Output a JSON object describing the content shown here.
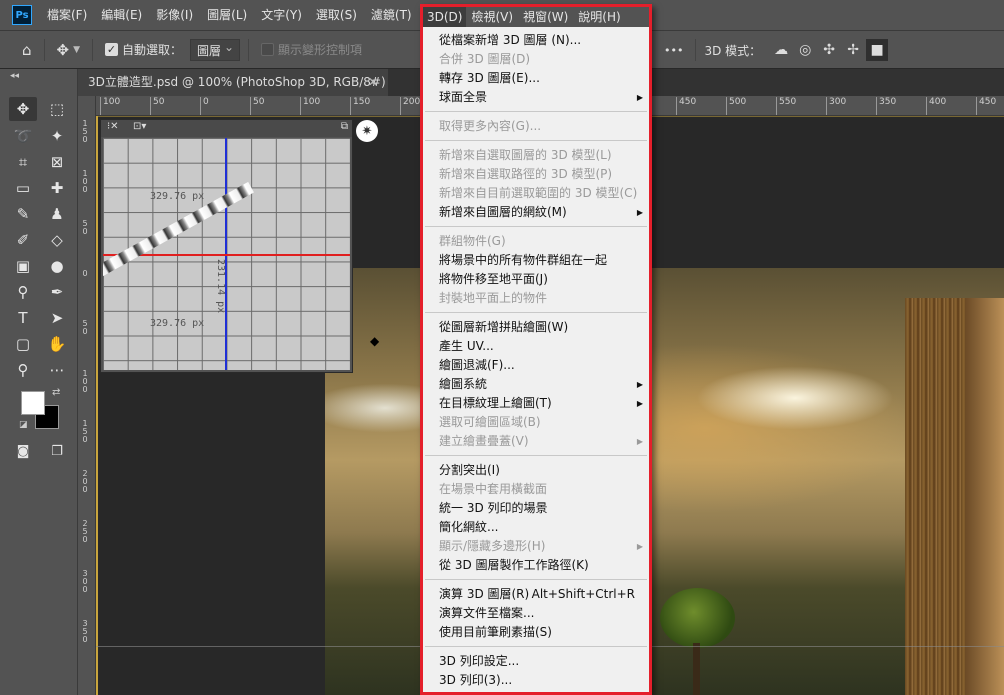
{
  "menubar": {
    "logo": "Ps",
    "items": [
      "檔案(F)",
      "編輯(E)",
      "影像(I)",
      "圖層(L)",
      "文字(Y)",
      "選取(S)",
      "濾鏡(T)",
      "3D(D)",
      "檢視(V)",
      "視窗(W)",
      "說明(H)"
    ]
  },
  "options": {
    "auto_select_label": "自動選取：",
    "auto_select_value": "圖層",
    "transform_controls_label": "顯示變形控制項",
    "more": "•••",
    "mode_label": "3D 模式："
  },
  "document": {
    "tab_title": "3D立體造型.psd @ 100% (PhotoShop 3D, RGB/8#)",
    "close": "✕"
  },
  "ruler": {
    "h_ticks": [
      "100",
      "50",
      "0",
      "50",
      "100",
      "150",
      "200",
      "250",
      "300",
      "350",
      "400",
      "450",
      "500",
      "550"
    ],
    "v_ticks": [
      "1 5 0",
      "1 0 0",
      "5 0",
      "0",
      "5 0",
      "1 0 0",
      "1 5 0",
      "2 0 0",
      "2 5 0",
      "3 0 0",
      "3 5 0",
      "4 0 0"
    ]
  },
  "secondary_view": {
    "dim_top": "329.76 px",
    "dim_bottom": "329.76 px",
    "dim_vertical": "231.14 px"
  },
  "dropdown": {
    "head_items": [
      "3D(D)",
      "檢視(V)",
      "視窗(W)",
      "說明(H)"
    ],
    "items": [
      {
        "label": "從檔案新增 3D 圖層 (N)...",
        "disabled": false
      },
      {
        "label": "合併 3D 圖層(D)",
        "disabled": true
      },
      {
        "label": "轉存 3D 圖層(E)...",
        "disabled": false
      },
      {
        "label": "球面全景",
        "disabled": false,
        "submenu": true
      },
      {
        "sep": true
      },
      {
        "label": "取得更多內容(G)...",
        "disabled": true
      },
      {
        "sep": true
      },
      {
        "label": "新增來自選取圖層的 3D 模型(L)",
        "disabled": true
      },
      {
        "label": "新增來自選取路徑的 3D 模型(P)",
        "disabled": true
      },
      {
        "label": "新增來自目前選取範圍的 3D 模型(C)",
        "disabled": true
      },
      {
        "label": "新增來自圖層的網紋(M)",
        "disabled": false,
        "submenu": true
      },
      {
        "sep": true
      },
      {
        "label": "群組物件(G)",
        "disabled": true
      },
      {
        "label": "將場景中的所有物件群組在一起",
        "disabled": false
      },
      {
        "label": "將物件移至地平面(J)",
        "disabled": false
      },
      {
        "label": "封裝地平面上的物件",
        "disabled": true
      },
      {
        "sep": true
      },
      {
        "label": "從圖層新增拼貼繪圖(W)",
        "disabled": false
      },
      {
        "label": "產生 UV...",
        "disabled": false
      },
      {
        "label": "繪圖退減(F)...",
        "disabled": false
      },
      {
        "label": "繪圖系統",
        "disabled": false,
        "submenu": true
      },
      {
        "label": "在目標紋理上繪圖(T)",
        "disabled": false,
        "submenu": true
      },
      {
        "label": "選取可繪圖區域(B)",
        "disabled": true
      },
      {
        "label": "建立繪畫疊蓋(V)",
        "disabled": true,
        "submenu": true
      },
      {
        "sep": true
      },
      {
        "label": "分割突出(I)",
        "disabled": false
      },
      {
        "label": "在場景中套用橫截面",
        "disabled": true
      },
      {
        "label": "統一 3D 列印的場景",
        "disabled": false
      },
      {
        "label": "簡化網紋...",
        "disabled": false
      },
      {
        "label": "顯示/隱藏多邊形(H)",
        "disabled": true,
        "submenu": true
      },
      {
        "label": "從 3D 圖層製作工作路徑(K)",
        "disabled": false
      },
      {
        "sep": true
      },
      {
        "label": "演算 3D 圖層(R)",
        "disabled": false,
        "shortcut": "Alt+Shift+Ctrl+R"
      },
      {
        "label": "演算文件至檔案...",
        "disabled": false
      },
      {
        "label": "使用目前筆刷素描(S)",
        "disabled": false
      },
      {
        "sep": true
      },
      {
        "label": "3D 列印設定...",
        "disabled": false
      },
      {
        "label": "3D 列印(3)...",
        "disabled": false
      }
    ]
  }
}
